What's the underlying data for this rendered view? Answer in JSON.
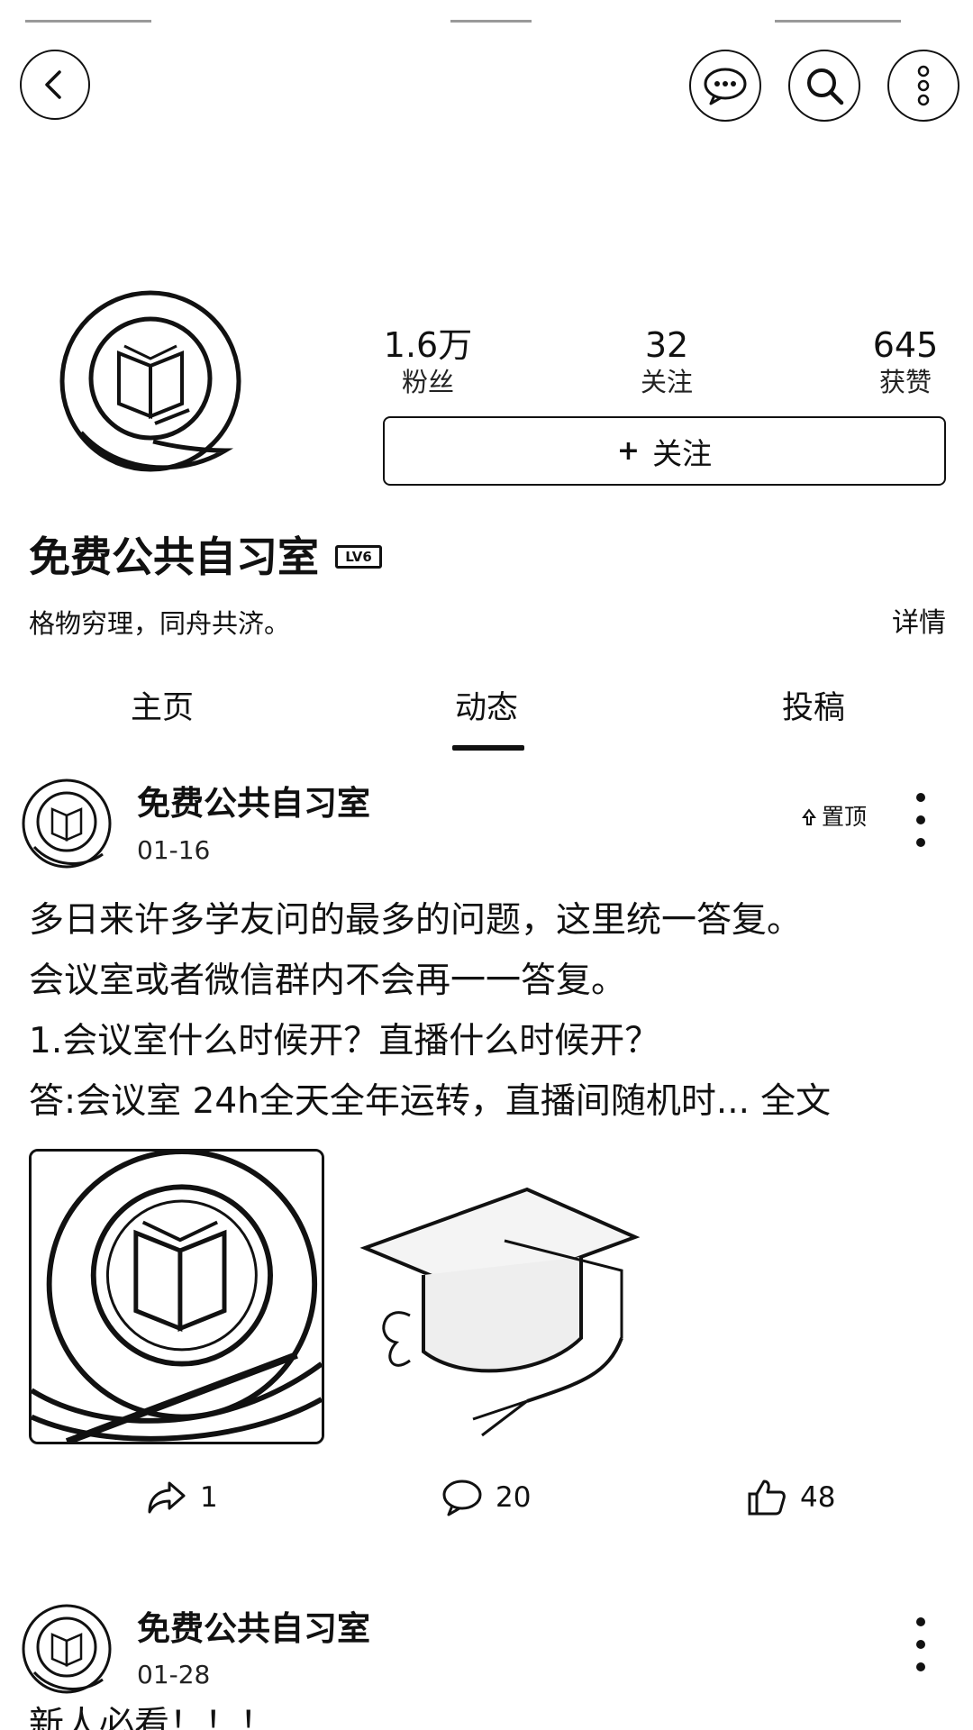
{
  "profile": {
    "name": "免费公共自习室",
    "level_badge": "LV6",
    "bio": "格物穷理，同舟共济。",
    "detail_label": "详情",
    "follow_label": "关注",
    "stats": [
      {
        "value": "1.6万",
        "label": "粉丝"
      },
      {
        "value": "32",
        "label": "关注"
      },
      {
        "value": "645",
        "label": "获赞"
      }
    ]
  },
  "tabs": [
    {
      "label": "主页",
      "active": false
    },
    {
      "label": "动态",
      "active": true
    },
    {
      "label": "投稿",
      "active": false
    }
  ],
  "posts": [
    {
      "author": "免费公共自习室",
      "date": "01-16",
      "pinned_label": "置顶",
      "lines": [
        "多日来许多学友问的最多的问题，这里统一答复。",
        "会议室或者微信群内不会再一一答复。",
        "1.会议室什么时候开？直播什么时候开？",
        "答:会议室 24h全天全年运转，直播间随机时..."
      ],
      "more_label": "全文",
      "share_count": "1",
      "comment_count": "20",
      "like_count": "48"
    },
    {
      "author": "免费公共自习室",
      "date": "01-28",
      "text_preview": "新人必看！！！"
    }
  ],
  "icons": {
    "back": "back-icon",
    "message": "message-icon",
    "search": "search-icon",
    "more": "more-vertical-icon",
    "share": "share-icon",
    "comment": "comment-icon",
    "like": "like-icon",
    "pin": "pin-icon"
  },
  "colors": {
    "foreground": "#111111",
    "background": "#ffffff"
  }
}
